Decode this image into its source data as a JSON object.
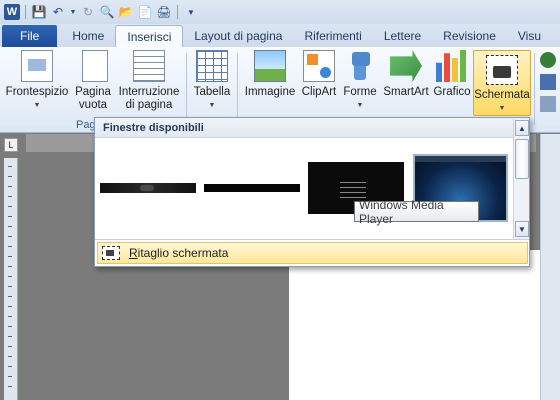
{
  "quick_access": {
    "icons": [
      "word-logo",
      "save-icon",
      "undo-icon",
      "redo-icon",
      "print-preview-icon",
      "open-icon",
      "new-icon",
      "print-icon",
      "customize-icon"
    ],
    "word_letter": "W"
  },
  "tabs": [
    "File",
    "Home",
    "Inserisci",
    "Layout di pagina",
    "Riferimenti",
    "Lettere",
    "Revisione",
    "Visu"
  ],
  "active_tab": "Inserisci",
  "ribbon": {
    "frontespizio": "Frontespizio",
    "pagina_line1": "Pagina",
    "pagina_line2": "vuota",
    "interruzione_line1": "Interruzione",
    "interruzione_line2": "di pagina",
    "pages_group_label": "Pag",
    "tabella": "Tabella",
    "immagine": "Immagine",
    "clipart": "ClipArt",
    "forme": "Forme",
    "smartart": "SmartArt",
    "grafico": "Grafico",
    "schermata": "Schermata"
  },
  "dropdown": {
    "header": "Finestre disponibili",
    "tooltip": "Windows Media Player",
    "clip_item_hotkey": "R",
    "clip_item_rest": "itaglio schermata"
  },
  "ruler_corner": "L",
  "colors": {
    "file_tab": "#2b5797",
    "highlight": "#ffd964",
    "ribbon_bg": "#dde8f5"
  }
}
